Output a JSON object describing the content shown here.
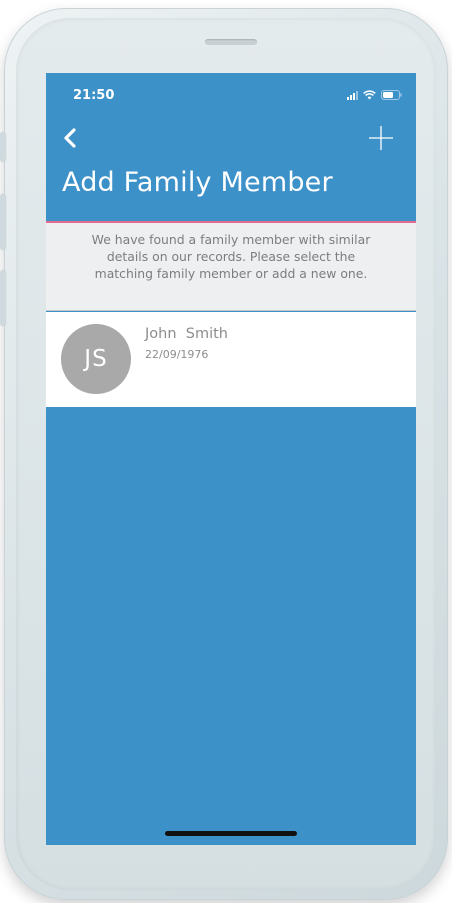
{
  "status_bar": {
    "time": "21:50",
    "icons": [
      "signal-icon",
      "wifi-icon",
      "battery-icon"
    ]
  },
  "nav": {
    "back_icon": "chevron-left-icon",
    "add_icon": "plus-icon",
    "title": "Add Family Member"
  },
  "notice": {
    "text": "We have found a family member with similar details on our records. Please select the matching family member or add a new one."
  },
  "members": [
    {
      "initials": "JS",
      "name": "John  Smith",
      "dob": "22/09/1976"
    }
  ],
  "colors": {
    "screen_background": "#3d91c9",
    "accent_line": "#e46b8d",
    "notice_background": "#eeeff1",
    "avatar_background": "#a9a9a9"
  }
}
